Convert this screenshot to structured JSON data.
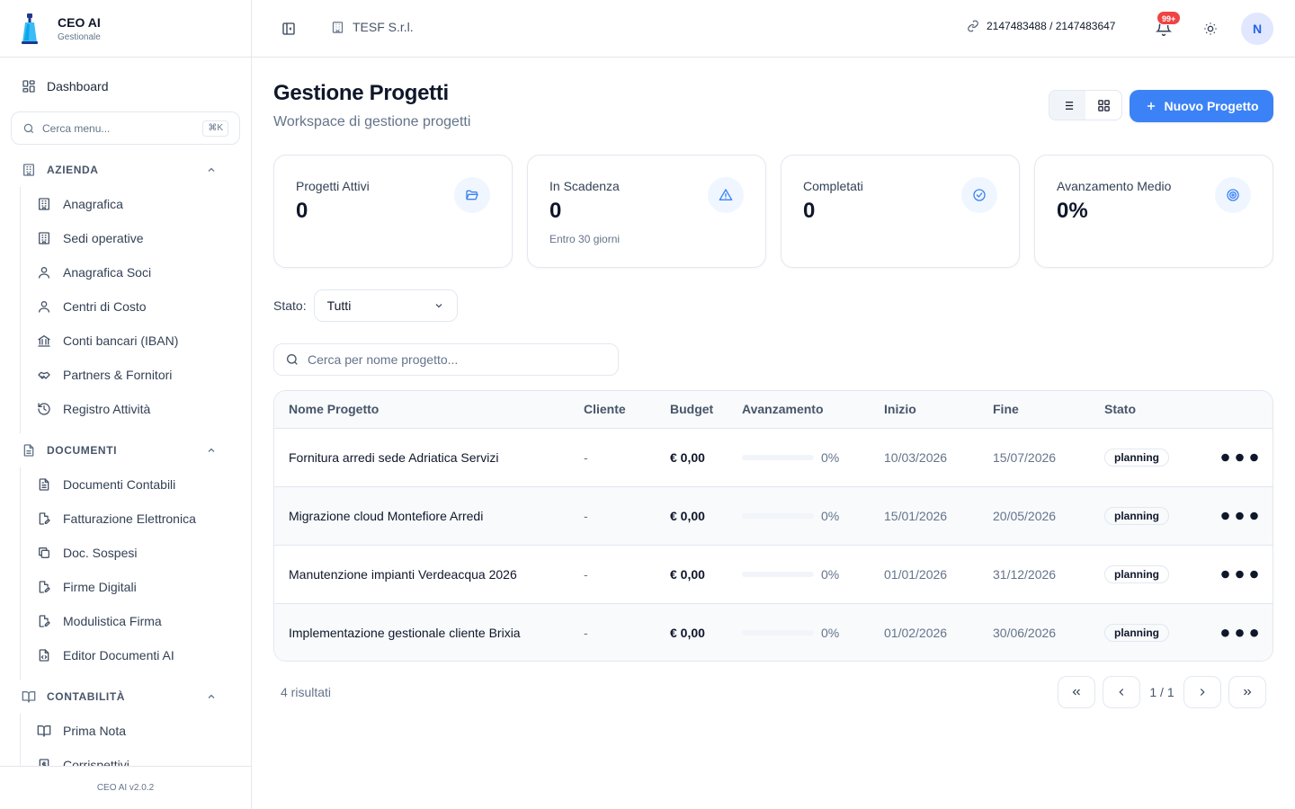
{
  "app": {
    "name": "CEO AI",
    "subtitle": "Gestionale",
    "version": "CEO AI v2.0.2"
  },
  "sidebar": {
    "dashboard": "Dashboard",
    "search_placeholder": "Cerca menu...",
    "search_shortcut": "⌘K",
    "sections": [
      {
        "title": "AZIENDA",
        "icon": "building-icon",
        "items": [
          {
            "label": "Anagrafica",
            "icon": "building-icon"
          },
          {
            "label": "Sedi operative",
            "icon": "building-icon"
          },
          {
            "label": "Anagrafica Soci",
            "icon": "user-icon"
          },
          {
            "label": "Centri di Costo",
            "icon": "user-icon"
          },
          {
            "label": "Conti bancari (IBAN)",
            "icon": "bank-icon"
          },
          {
            "label": "Partners & Fornitori",
            "icon": "handshake-icon"
          },
          {
            "label": "Registro Attività",
            "icon": "history-icon"
          }
        ]
      },
      {
        "title": "DOCUMENTI",
        "icon": "file-icon",
        "items": [
          {
            "label": "Documenti Contabili",
            "icon": "file-text-icon"
          },
          {
            "label": "Fatturazione Elettronica",
            "icon": "file-edit-icon"
          },
          {
            "label": "Doc. Sospesi",
            "icon": "copy-icon"
          },
          {
            "label": "Firme Digitali",
            "icon": "file-edit-icon"
          },
          {
            "label": "Modulistica Firma",
            "icon": "file-edit-icon"
          },
          {
            "label": "Editor Documenti AI",
            "icon": "file-code-icon"
          }
        ]
      },
      {
        "title": "CONTABILITÀ",
        "icon": "book-icon",
        "items": [
          {
            "label": "Prima Nota",
            "icon": "book-icon"
          },
          {
            "label": "Corrispettivi",
            "icon": "receipt-icon"
          }
        ]
      }
    ]
  },
  "header": {
    "company": "TESF S.r.l.",
    "ids": "2147483488 / 2147483647",
    "notifications_badge": "99+",
    "avatar_initial": "N"
  },
  "page": {
    "title": "Gestione Progetti",
    "subtitle": "Workspace di gestione progetti",
    "new_button": "Nuovo Progetto"
  },
  "stats": [
    {
      "label": "Progetti Attivi",
      "value": "0",
      "note": "",
      "icon": "folder-open-icon"
    },
    {
      "label": "In Scadenza",
      "value": "0",
      "note": "Entro 30 giorni",
      "icon": "alert-triangle-icon"
    },
    {
      "label": "Completati",
      "value": "0",
      "note": "",
      "icon": "check-circle-icon"
    },
    {
      "label": "Avanzamento Medio",
      "value": "0%",
      "note": "",
      "icon": "target-icon"
    }
  ],
  "filter": {
    "label": "Stato:",
    "value": "Tutti"
  },
  "search": {
    "placeholder": "Cerca per nome progetto..."
  },
  "table": {
    "columns": [
      "Nome Progetto",
      "Cliente",
      "Budget",
      "Avanzamento",
      "Inizio",
      "Fine",
      "Stato"
    ],
    "rows": [
      {
        "name": "Fornitura arredi sede Adriatica Servizi",
        "client": "-",
        "budget": "€ 0,00",
        "progress": 0,
        "progress_label": "0%",
        "start": "10/03/2026",
        "end": "15/07/2026",
        "status": "planning"
      },
      {
        "name": "Migrazione cloud Montefiore Arredi",
        "client": "-",
        "budget": "€ 0,00",
        "progress": 0,
        "progress_label": "0%",
        "start": "15/01/2026",
        "end": "20/05/2026",
        "status": "planning"
      },
      {
        "name": "Manutenzione impianti Verdeacqua 2026",
        "client": "-",
        "budget": "€ 0,00",
        "progress": 0,
        "progress_label": "0%",
        "start": "01/01/2026",
        "end": "31/12/2026",
        "status": "planning"
      },
      {
        "name": "Implementazione gestionale cliente Brixia",
        "client": "-",
        "budget": "€ 0,00",
        "progress": 0,
        "progress_label": "0%",
        "start": "01/02/2026",
        "end": "30/06/2026",
        "status": "planning"
      }
    ]
  },
  "pagination": {
    "results": "4 risultati",
    "page": "1 / 1"
  },
  "colors": {
    "primary": "#3b82f6",
    "badge": "#ef4444",
    "icon_bg": "#eff6ff"
  }
}
